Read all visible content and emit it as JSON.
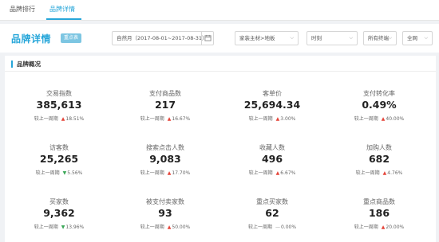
{
  "nav": {
    "tabs": [
      {
        "label": "品牌排行",
        "active": false
      },
      {
        "label": "品牌详情",
        "active": true
      }
    ]
  },
  "header": {
    "title": "品牌详情",
    "badge": "重点表",
    "date_range": "自然月（2017-08-01~2017-08-31）",
    "category": "家装主材>地板",
    "period": "时刻",
    "terminal": "所有终端",
    "network": "全网"
  },
  "section": {
    "title": "品牌概况"
  },
  "compare_label": "较上一周期",
  "colors": {
    "accent": "#26a6d9",
    "up": "#e5453a",
    "down": "#3aa757",
    "flat": "#999999"
  },
  "metrics": [
    {
      "name": "交易指数",
      "value": "385,613",
      "trend": "up",
      "change": "18.51%"
    },
    {
      "name": "支付商品数",
      "value": "217",
      "trend": "up",
      "change": "16.67%"
    },
    {
      "name": "客单价",
      "value": "25,694.34",
      "trend": "up",
      "change": "3.00%"
    },
    {
      "name": "支付转化率",
      "value": "0.49%",
      "trend": "up",
      "change": "40.00%"
    },
    {
      "name": "访客数",
      "value": "25,265",
      "trend": "down",
      "change": "5.56%"
    },
    {
      "name": "搜索点击人数",
      "value": "9,083",
      "trend": "up",
      "change": "17.70%"
    },
    {
      "name": "收藏人数",
      "value": "496",
      "trend": "up",
      "change": "6.67%"
    },
    {
      "name": "加购人数",
      "value": "682",
      "trend": "up",
      "change": "4.76%"
    },
    {
      "name": "买家数",
      "value": "9,362",
      "trend": "down",
      "change": "13.96%"
    },
    {
      "name": "被支付卖家数",
      "value": "93",
      "trend": "up",
      "change": "50.00%"
    },
    {
      "name": "重点买家数",
      "value": "62",
      "trend": "flat",
      "change": "0.00%"
    },
    {
      "name": "重点商品数",
      "value": "186",
      "trend": "up",
      "change": "20.00%"
    }
  ]
}
